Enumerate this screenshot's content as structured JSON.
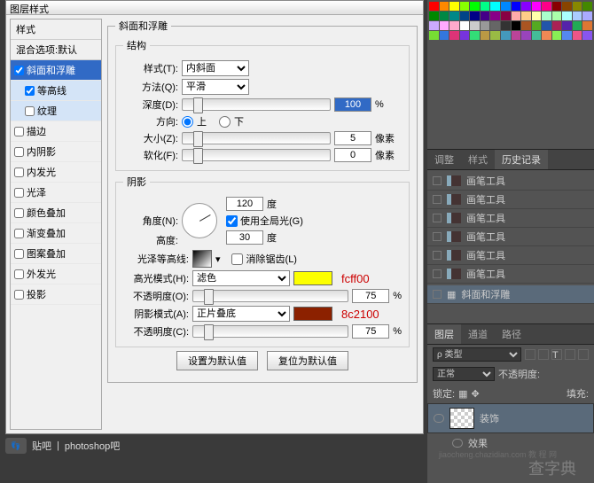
{
  "dialog": {
    "title": "图层样式",
    "stylesHeader": "样式",
    "blendDefault": "混合选项:默认",
    "items": [
      {
        "label": "斜面和浮雕",
        "checked": true,
        "sel": true
      },
      {
        "label": "等高线",
        "checked": true,
        "sub": true
      },
      {
        "label": "纹理",
        "checked": false,
        "sub": true
      },
      {
        "label": "描边",
        "checked": false
      },
      {
        "label": "内阴影",
        "checked": false
      },
      {
        "label": "内发光",
        "checked": false
      },
      {
        "label": "光泽",
        "checked": false
      },
      {
        "label": "颜色叠加",
        "checked": false
      },
      {
        "label": "渐变叠加",
        "checked": false
      },
      {
        "label": "图案叠加",
        "checked": false
      },
      {
        "label": "外发光",
        "checked": false
      },
      {
        "label": "投影",
        "checked": false
      }
    ],
    "bevel": {
      "groupTitle": "斜面和浮雕",
      "structTitle": "结构",
      "styleLabel": "样式(T):",
      "styleValue": "内斜面",
      "techLabel": "方法(Q):",
      "techValue": "平滑",
      "depthLabel": "深度(D):",
      "depthValue": "100",
      "pct": "%",
      "dirLabel": "方向:",
      "up": "上",
      "down": "下",
      "sizeLabel": "大小(Z):",
      "sizeValue": "5",
      "px": "像素",
      "softLabel": "软化(F):",
      "softValue": "0"
    },
    "shade": {
      "title": "阴影",
      "angleLabel": "角度(N):",
      "angleValue": "120",
      "deg": "度",
      "globalLabel": "使用全局光(G)",
      "altLabel": "高度:",
      "altValue": "30",
      "glossLabel": "光泽等高线:",
      "aaLabel": "消除锯齿(L)",
      "hiLabel": "高光模式(H):",
      "hiMode": "滤色",
      "hiColor": "#fcff00",
      "hiAnn": "fcff00",
      "opLabel": "不透明度(O):",
      "opValue": "75",
      "shLabel": "阴影模式(A):",
      "shMode": "正片叠底",
      "shColor": "#8c2100",
      "shAnn": "8c2100",
      "opLabel2": "不透明度(C):",
      "opValue2": "75"
    },
    "btnDefault": "设置为默认值",
    "btnReset": "复位为默认值"
  },
  "right": {
    "tabsA": [
      "调整",
      "样式",
      "历史记录"
    ],
    "history": [
      "画笔工具",
      "画笔工具",
      "画笔工具",
      "画笔工具",
      "画笔工具",
      "画笔工具"
    ],
    "historyFx": "斜面和浮雕",
    "tabsB": [
      "图层",
      "通道",
      "路径"
    ],
    "kind": "类型",
    "blend": "正常",
    "opLabel": "不透明度:",
    "lock": "锁定:",
    "fill": "填充:",
    "layerName": "装饰",
    "fxLabel": "效果"
  },
  "footer": {
    "site": "贴吧",
    "app": "photoshop吧"
  },
  "wm": {
    "a": "查字典",
    "b": "jiaocheng.chazidian.com 教 程 网"
  },
  "swatchColors": [
    "#f00",
    "#f80",
    "#ff0",
    "#8f0",
    "#0f0",
    "#0f8",
    "#0ff",
    "#08f",
    "#00f",
    "#80f",
    "#f0f",
    "#f08",
    "#800",
    "#840",
    "#880",
    "#480",
    "#080",
    "#084",
    "#088",
    "#048",
    "#008",
    "#408",
    "#808",
    "#804",
    "#faa",
    "#fc8",
    "#ffa",
    "#afc",
    "#afa",
    "#aff",
    "#acf",
    "#aaf",
    "#caf",
    "#faf",
    "#fac",
    "#fff",
    "#ccc",
    "#999",
    "#666",
    "#333",
    "#000",
    "#a52",
    "#5a2",
    "#25a",
    "#a25",
    "#52a",
    "#2a5",
    "#d73",
    "#7d3",
    "#37d",
    "#d37",
    "#73d",
    "#3d7",
    "#b94",
    "#9b4",
    "#49b",
    "#b49",
    "#94b",
    "#4b9",
    "#e85",
    "#8e5",
    "#58e",
    "#e58",
    "#85e"
  ]
}
